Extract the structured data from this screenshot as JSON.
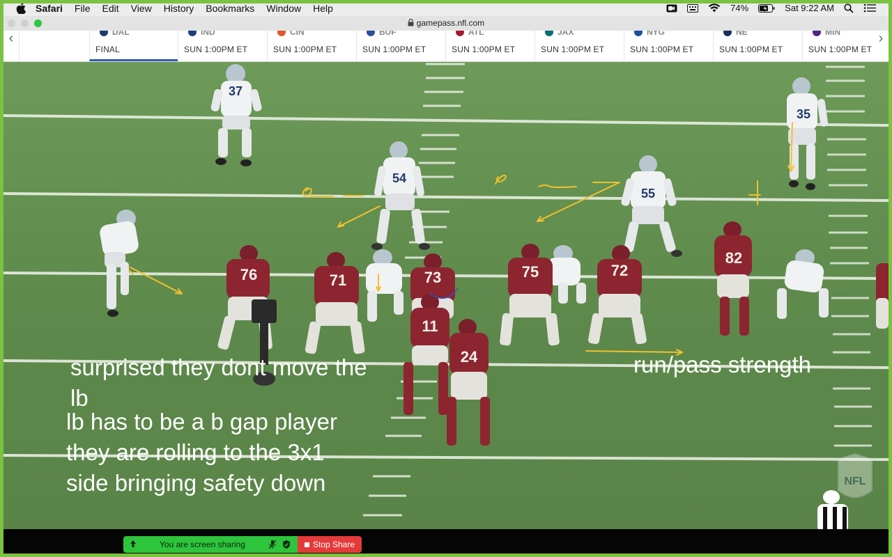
{
  "menubar": {
    "app": "Safari",
    "items": [
      "File",
      "Edit",
      "View",
      "History",
      "Bookmarks",
      "Window",
      "Help"
    ],
    "battery": "74%",
    "clock": "Sat 9:22 AM"
  },
  "browser": {
    "url": "gamepass.nfl.com"
  },
  "scores": {
    "games": [
      {
        "team": "",
        "time": ""
      },
      {
        "team": "DAL",
        "time": "FINAL"
      },
      {
        "team": "IND",
        "time": "SUN 1:00PM ET"
      },
      {
        "team": "CIN",
        "time": "SUN 1:00PM ET"
      },
      {
        "team": "BUF",
        "time": "SUN 1:00PM ET"
      },
      {
        "team": "ATL",
        "time": "SUN 1:00PM ET"
      },
      {
        "team": "JAX",
        "time": "SUN 1:00PM ET"
      },
      {
        "team": "NYG",
        "time": "SUN 1:00PM ET"
      },
      {
        "team": "NE",
        "time": "SUN 1:00PM ET"
      },
      {
        "team": "MIN",
        "time": "SUN 1:00PM ET"
      }
    ],
    "logo_colors": [
      "#888888",
      "#1d3a6e",
      "#1f3d7a",
      "#e0592a",
      "#2a4f9b",
      "#a71930",
      "#0a6d74",
      "#1b4fa0",
      "#1b2f5c",
      "#4f2683"
    ]
  },
  "field": {
    "annotations": {
      "note1_line1": "surprised they dont move the",
      "note1_line2": "lb",
      "note2_line1": "lb has to be a b gap player",
      "note2_line2": "they are rolling to the 3x1",
      "note2_line3": "side bringing safety down",
      "note3": "run/pass strength"
    },
    "defense_numbers": [
      "37",
      "54",
      "55",
      "35"
    ],
    "offense_numbers": [
      "76",
      "71",
      "73",
      "75",
      "72",
      "82",
      "11",
      "24"
    ],
    "watermark": "NFL",
    "colors": {
      "field": "#628e4f",
      "annotation_ink": "#f2c12e",
      "burgundy": "#7a1f2b",
      "gold": "#d8b96b"
    }
  },
  "zoom": {
    "sharing_label": "You are screen sharing",
    "stop_label": "Stop Share"
  }
}
